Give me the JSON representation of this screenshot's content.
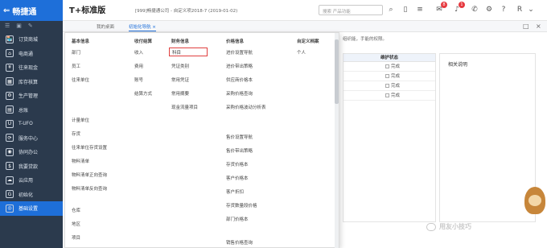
{
  "app": {
    "logo_text": "畅捷通",
    "product_name": "T+标准版",
    "account_info": "[999]畅捷通公司 - 自定义项2018-7 (2019-01-02)",
    "search_placeholder": "搜索 产品功能"
  },
  "topbar": {
    "badges": [
      "8",
      "1"
    ],
    "user_initial": "R"
  },
  "sidebar": {
    "items": [
      {
        "icon": "🏪",
        "label": "订货商城"
      },
      {
        "icon": "⌂",
        "label": "电商通"
      },
      {
        "icon": "¥",
        "label": "往来现金"
      },
      {
        "icon": "▦",
        "label": "库存核算"
      },
      {
        "icon": "⚙",
        "label": "生产管理"
      },
      {
        "icon": "▤",
        "label": "总账"
      },
      {
        "icon": "U",
        "label": "T-UFO"
      },
      {
        "icon": "⟳",
        "label": "服务中心"
      },
      {
        "icon": "◉",
        "label": "协同办公"
      },
      {
        "icon": "$",
        "label": "我要贷款"
      },
      {
        "icon": "☁",
        "label": "云应用"
      },
      {
        "icon": "G",
        "label": "初始化"
      },
      {
        "icon": "◎",
        "label": "基础设置"
      }
    ],
    "active_index": 12
  },
  "tabs": {
    "items": [
      {
        "label": "我的桌面"
      },
      {
        "label": "初始化导航 ×"
      }
    ],
    "active_index": 1
  },
  "mega_menu": {
    "columns": [
      {
        "heading": "基本信息",
        "items": [
          "部门",
          "员工",
          "往来单位",
          "计量单位",
          "存货",
          "往来单位存货设置",
          "物料清单",
          "物料清单正向查询",
          "物料清单反向查询",
          "仓库",
          "地区",
          "项目"
        ]
      },
      {
        "heading": "收付结算",
        "items": [
          "收入",
          "费用",
          "账号",
          "结算方式"
        ]
      },
      {
        "heading": "财务信息",
        "items": [
          "科目",
          "凭证类别",
          "常用凭证",
          "常用摘要",
          "现金流量项目"
        ],
        "highlighted_index": 0
      },
      {
        "heading": "价格信息",
        "items": [
          "进价设置导航",
          "进价带出策略",
          "供应商价格本",
          "采购价格查询",
          "采购价格波动分析表",
          "售价设置导航",
          "售价带出策略",
          "存货价格本",
          "客户价格本",
          "客户折扣",
          "存货数量段价格",
          "部门价格本",
          "销售价格查询"
        ]
      },
      {
        "heading": "自定义档案",
        "items": [
          "个人"
        ]
      }
    ]
  },
  "background": {
    "notice": "组织能，手能的权限。",
    "table_header": "维护状态",
    "rows": [
      "完成",
      "完成",
      "完成",
      "完成"
    ],
    "related_label": "相关说明"
  },
  "watermark": {
    "text": "用友小技巧"
  }
}
